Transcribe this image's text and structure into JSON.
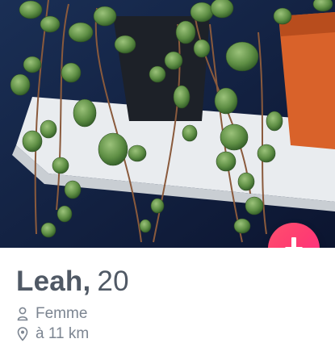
{
  "profile": {
    "name": "Leah,",
    "age": "20",
    "gender": "Femme",
    "distance": "à 11 km",
    "gender_icon": "user-icon",
    "distance_icon": "location-pin-icon"
  },
  "actions": {
    "expand_icon": "arrow-down-icon",
    "accent_color": "#fe3c72"
  },
  "photo": {
    "subject": "string-of-hearts plant"
  }
}
